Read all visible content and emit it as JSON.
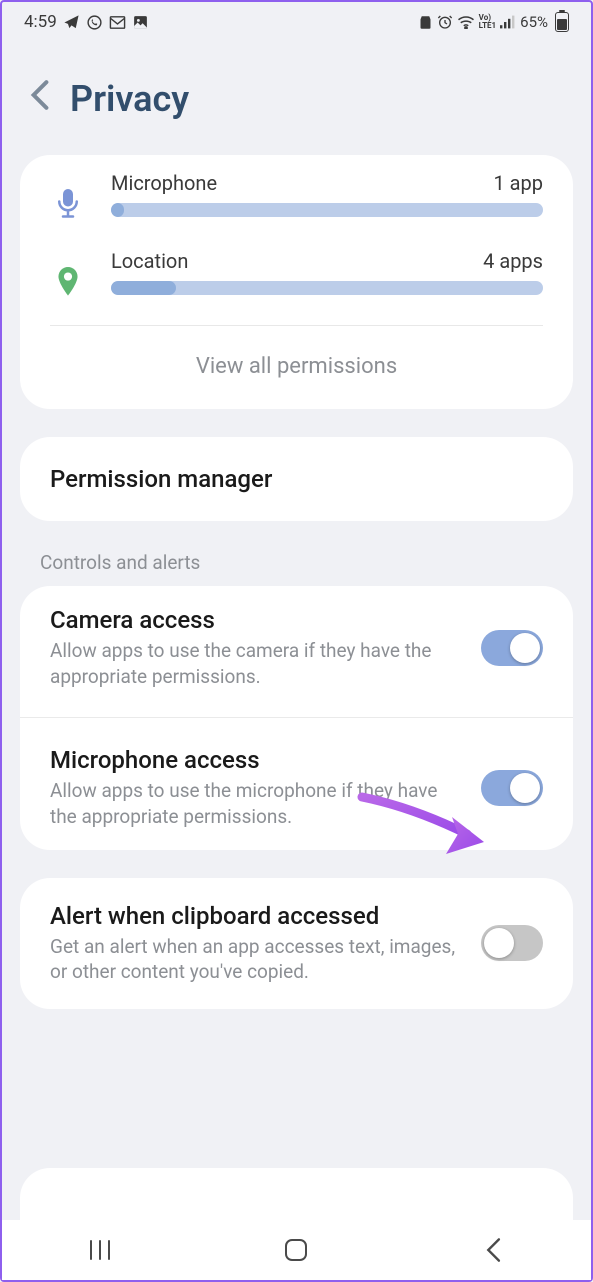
{
  "statusBar": {
    "time": "4:59",
    "batteryPct": "65%"
  },
  "header": {
    "title": "Privacy"
  },
  "permissions": {
    "microphone": {
      "label": "Microphone",
      "count": "1 app",
      "fillPct": 3
    },
    "location": {
      "label": "Location",
      "count": "4 apps",
      "fillPct": 15
    },
    "viewAll": "View all permissions"
  },
  "permManager": {
    "label": "Permission manager"
  },
  "sectionLabel": "Controls and alerts",
  "camera": {
    "title": "Camera access",
    "desc": "Allow apps to use the camera if they have the appropriate permissions.",
    "on": true
  },
  "mic": {
    "title": "Microphone access",
    "desc": "Allow apps to use the microphone if they have the appropriate permissions.",
    "on": true
  },
  "clipboard": {
    "title": "Alert when clipboard accessed",
    "desc": "Get an alert when an app accesses text, images, or other content you've copied.",
    "on": false
  }
}
